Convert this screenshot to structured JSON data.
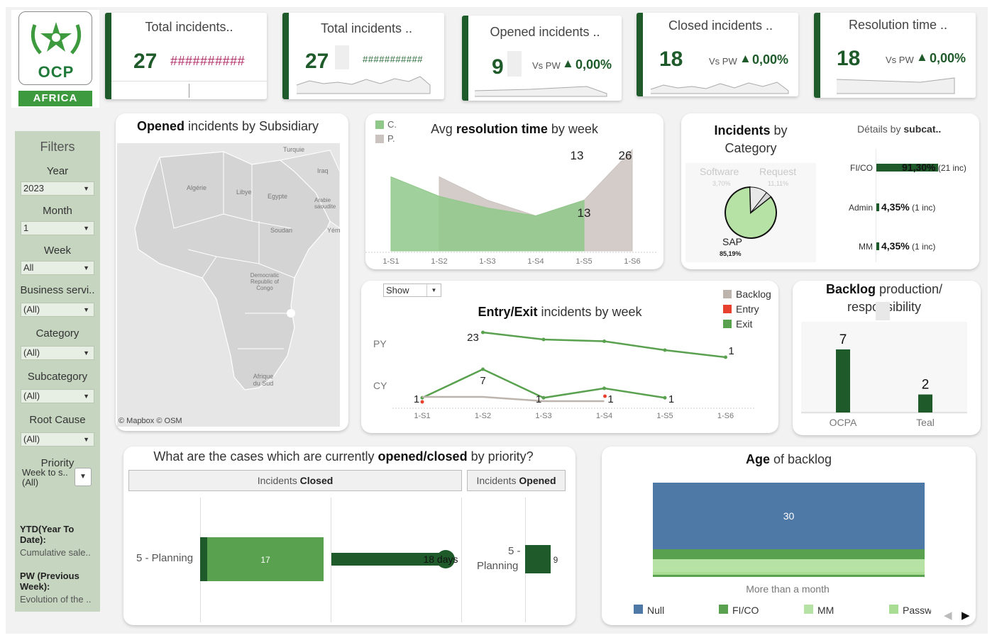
{
  "logo": {
    "name": "OCP",
    "sub": "AFRICA"
  },
  "kpis": [
    {
      "title": "Total incidents..",
      "value": "27",
      "hash": "##########"
    },
    {
      "title": "Total incidents ..",
      "value": "27",
      "hash": "###########"
    },
    {
      "title": "Opened incidents ..",
      "value": "9",
      "vs": "Vs PW",
      "pct": "0,00%"
    },
    {
      "title": "Closed incidents ..",
      "value": "18",
      "vs": "Vs PW",
      "pct": "0,00%"
    },
    {
      "title": "Resolution time ..",
      "value": "18",
      "vs": "Vs PW",
      "pct": "0,00%"
    }
  ],
  "filters": {
    "title": "Filters",
    "items": [
      {
        "label": "Year",
        "value": "2023"
      },
      {
        "label": "Month",
        "value": "1"
      },
      {
        "label": "Week",
        "value": "All"
      },
      {
        "label": "Business servi..",
        "value": "(All)"
      },
      {
        "label": "Category",
        "value": "(All)"
      },
      {
        "label": "Subcategory",
        "value": "(All)"
      },
      {
        "label": "Root Cause",
        "value": "(All)"
      },
      {
        "label": "Priority",
        "value": "(All)"
      }
    ],
    "week_to_s": "Week to s..",
    "notes": [
      {
        "title": "YTD(Year To Date):",
        "text": "Cumulative sale.."
      },
      {
        "title": "PW (Previous Week):",
        "text": "Evolution of the .."
      }
    ]
  },
  "map": {
    "title_bold": "Opened",
    "title_rest": " incidents by Subsidiary",
    "labels": [
      "Turquie",
      "Iraq",
      "Algérie",
      "Libye",
      "Egypte",
      "Arabie saoudite",
      "Soudan",
      "Yém",
      "Democratic Republic of Congo",
      "Afrique du Sud"
    ],
    "credit": "© Mapbox © OSM"
  },
  "avg_resolution": {
    "title_pre": "Avg ",
    "title_bold": "resolution time",
    "title_post": " by week",
    "legend": [
      "C.",
      "P."
    ],
    "labels": [
      "13",
      "26",
      "13"
    ]
  },
  "category": {
    "title_bold": "Incidents",
    "title_rest": " by",
    "title_line2": "Category",
    "details_pre": "Détails by ",
    "details_bold": "subcat..",
    "slices": [
      {
        "name": "Software",
        "pct": "3,70%"
      },
      {
        "name": "Request",
        "pct": "11,11%"
      },
      {
        "name": "SAP",
        "pct": "85,19%"
      }
    ],
    "subcats": [
      {
        "name": "FI/CO",
        "pct": "91,30%",
        "inc": "(21 inc)",
        "value": 0.913
      },
      {
        "name": "Admin",
        "pct": "4,35%",
        "inc": "(1 inc)",
        "value": 0.0435
      },
      {
        "name": "MM",
        "pct": "4,35%",
        "inc": "(1 inc)",
        "value": 0.0435
      }
    ]
  },
  "entry_exit": {
    "show_label": "Show",
    "title_bold": "Entry/Exit",
    "title_rest": " incidents by week",
    "legend": [
      {
        "name": "Backlog",
        "color": "#bdb4ae"
      },
      {
        "name": "Entry",
        "color": "#e8402e"
      },
      {
        "name": "Exit",
        "color": "#59a14f"
      }
    ],
    "row_labels": [
      "PY",
      "CY"
    ]
  },
  "backlog": {
    "title_bold": "Backlog",
    "title_rest": " production/",
    "title_line2": "responsibility"
  },
  "opened_closed": {
    "question_pre": "What are the cases which are currently ",
    "question_bold": "opened/closed",
    "question_post": " by priority?",
    "closed_header_pre": "Incidents ",
    "closed_header_bold": "Closed",
    "opened_header_pre": "Incidents ",
    "opened_header_bold": "Opened",
    "row_label": "5 - Planning",
    "opened_row_label_1": "5 -",
    "opened_row_label_2": "Planning",
    "closed_count": "17",
    "closed_days": "18 days",
    "opened_count": "9"
  },
  "age_backlog": {
    "title_bold": "Age",
    "title_rest": " of backlog",
    "value_label": "30",
    "category": "More than a month",
    "legend": [
      {
        "name": "Null",
        "color": "#4e79a7"
      },
      {
        "name": "FI/CO",
        "color": "#59a14f"
      },
      {
        "name": "MM",
        "color": "#b7e2a6"
      },
      {
        "name": "Passw",
        "color": "#a9dd94"
      }
    ]
  },
  "chart_data": [
    {
      "type": "area",
      "title": "Avg resolution time by week",
      "categories": [
        "1-S1",
        "1-S2",
        "1-S3",
        "1-S4",
        "1-S5",
        "1-S6"
      ],
      "series": [
        {
          "name": "C.",
          "values": [
            19,
            14,
            11,
            9,
            13,
            null
          ],
          "color": "#8fc889"
        },
        {
          "name": "P.",
          "values": [
            null,
            19,
            13,
            9,
            13,
            26
          ],
          "color": "#cbc3bf"
        }
      ],
      "data_labels": [
        {
          "x": "1-S5",
          "value": 13,
          "text": "13"
        },
        {
          "x": "1-S6",
          "value": 26,
          "text": "26"
        },
        {
          "x": "1-S5",
          "value": 13,
          "text": "13"
        }
      ],
      "ylim": [
        0,
        28
      ]
    },
    {
      "type": "line",
      "title": "Entry/Exit incidents by week",
      "categories": [
        "1-S1",
        "1-S2",
        "1-S3",
        "1-S4",
        "1-S5",
        "1-S6"
      ],
      "series": [
        {
          "name": "PY Exit",
          "values": [
            null,
            23,
            21,
            20.5,
            18,
            16
          ],
          "color": "#59a14f"
        },
        {
          "name": "CY Exit",
          "values": [
            1,
            7,
            1,
            3,
            1,
            null
          ],
          "color": "#59a14f"
        },
        {
          "name": "CY Backlog",
          "values": [
            1,
            1,
            0,
            0,
            null,
            null
          ],
          "color": "#bdb4ae"
        }
      ],
      "data_labels": [
        {
          "x": "1-S2",
          "text": "23"
        },
        {
          "x": "1-S6",
          "text": "1"
        },
        {
          "x": "1-S1",
          "text": "1"
        },
        {
          "x": "1-S2",
          "text": "7"
        },
        {
          "x": "1-S3",
          "text": "1"
        },
        {
          "x": "1-S4",
          "text": "1"
        },
        {
          "x": "1-S5",
          "text": "1"
        }
      ]
    },
    {
      "type": "bar",
      "title": "Backlog production/ responsibility",
      "categories": [
        "OCPA",
        "Teal"
      ],
      "values": [
        7,
        2
      ],
      "ylim": [
        0,
        8
      ]
    },
    {
      "type": "pie",
      "title": "Incidents by Category",
      "categories": [
        "SAP",
        "Request",
        "Software"
      ],
      "values": [
        85.19,
        11.11,
        3.7
      ]
    },
    {
      "type": "bar",
      "title": "Opened/closed by priority",
      "categories": [
        "5 - Planning"
      ],
      "series": [
        {
          "name": "Incidents Closed",
          "values": [
            17
          ]
        },
        {
          "name": "Days",
          "values": [
            18
          ]
        },
        {
          "name": "Incidents Opened",
          "values": [
            9
          ]
        }
      ]
    },
    {
      "type": "bar",
      "title": "Age of backlog",
      "categories": [
        "More than a month"
      ],
      "series": [
        {
          "name": "Null",
          "values": [
            30
          ]
        },
        {
          "name": "FI/CO",
          "values": [
            3
          ]
        },
        {
          "name": "MM",
          "values": [
            2
          ]
        },
        {
          "name": "Passw",
          "values": [
            1
          ]
        }
      ]
    }
  ]
}
